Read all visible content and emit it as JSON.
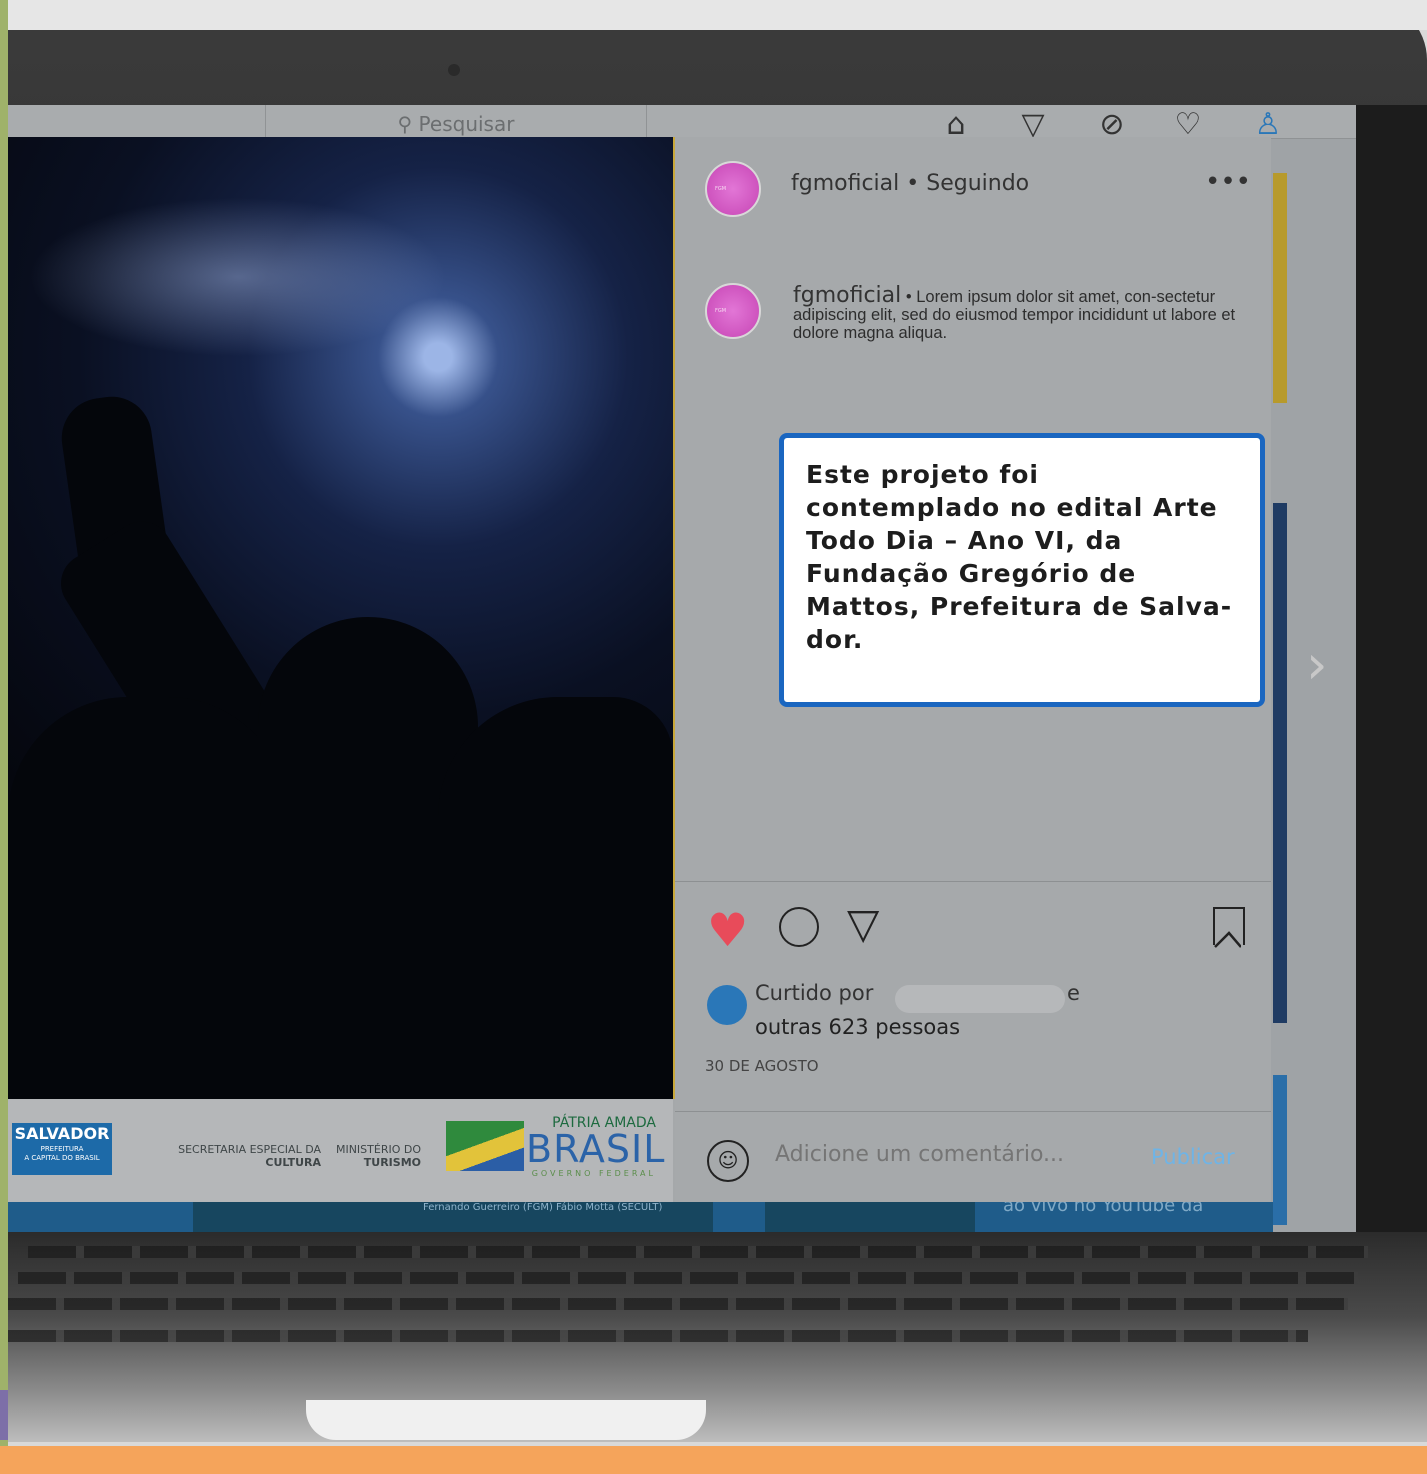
{
  "search": {
    "placeholder": "Pesquisar"
  },
  "nav": {
    "home_icon": "⌂",
    "direct_icon": "▽",
    "explore_icon": "⊘",
    "activity_icon": "♡",
    "profile_icon": "♙"
  },
  "post": {
    "username": "fgmoficial",
    "following": "• Seguindo",
    "more": "•••",
    "avatar_label": "FGM",
    "caption_user": "fgmoficial",
    "caption_text": " • Lorem ipsum dolor sit amet, con-sectetur adipiscing elit, sed do eiusmod tempor incididunt ut labore et dolore magna aliqua.",
    "notice": "Este projeto foi contemplado no edital Arte Todo Dia – Ano VI, da Fundação Gregório de Mattos, Prefeitura de Salva-dor.",
    "liked_by": "Curtido por",
    "liked_and": "e",
    "liked_others": "outras 623 pessoas",
    "date": "30 DE AGOSTO",
    "comment_placeholder": "Adicione um comentário...",
    "publish": "Publicar"
  },
  "photo": {
    "logos": {
      "salvador": "SALVADOR",
      "salvador_sub": "PREFEITURA",
      "salvador_tag": "A CAPITAL DO BRASIL",
      "secretaria": "SECRETARIA ESPECIAL DA",
      "cultura": "CULTURA",
      "ministerio": "MINISTÉRIO DO",
      "turismo": "TURISMO",
      "patria": "PÁTRIA AMADA",
      "brasil": "BRASIL",
      "gov": "GOVERNO FEDERAL"
    }
  },
  "feed": {
    "bottom_credits": "Fernando Guerreiro (FGM) Fábio Motta (SECULT)",
    "bottom_text": "ao vivo no YouTube da"
  },
  "colors": {
    "accent_blue": "#1a66c0",
    "heart": "#e84b5a",
    "publish": "#6fb4e6",
    "bottom_bar": "#f5a45b"
  }
}
